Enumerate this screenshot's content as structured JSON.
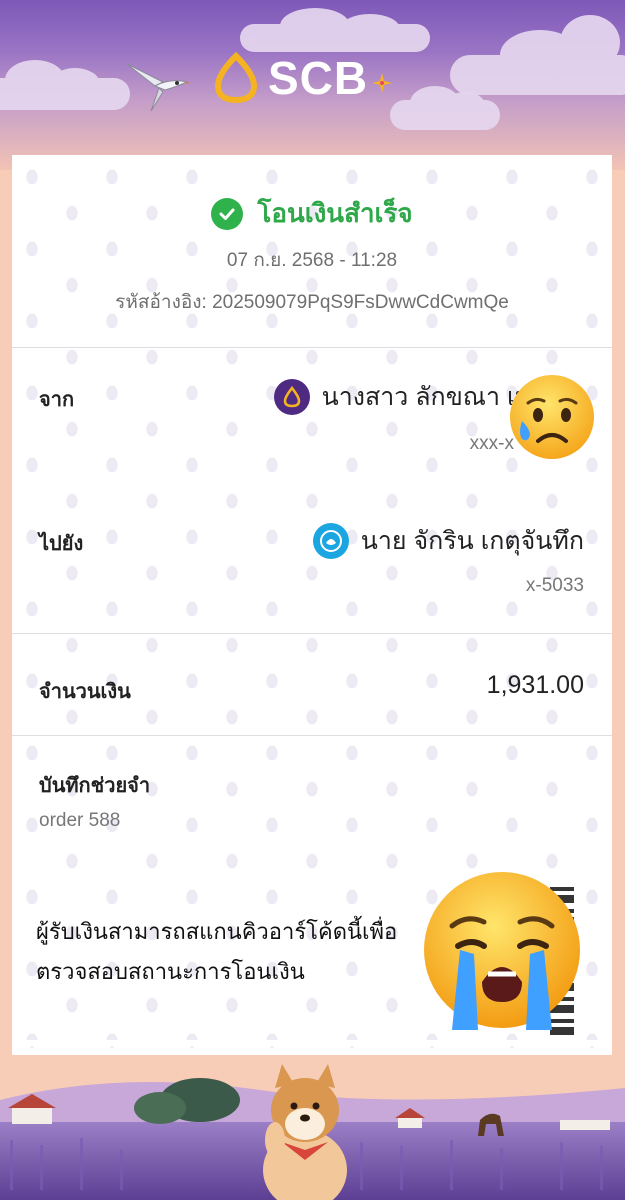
{
  "brand": {
    "name": "SCB"
  },
  "status": {
    "text": "โอนเงินสำเร็จ"
  },
  "datetime": "07 ก.ย. 2568 - 11:28",
  "reference": "รหัสอ้างอิง: 202509079PqS9FsDwwCdCwmQe",
  "from": {
    "label": "จาก",
    "name": "นางสาว ลักขณา เพ",
    "account": "xxx-x",
    "bank_icon": "scb-logo-icon"
  },
  "to": {
    "label": "ไปยัง",
    "name": "นาย จักริน เกตุจันทึก",
    "account": "x-5033",
    "bank_icon": "ktb-logo-icon"
  },
  "amount": {
    "label": "จำนวนเงิน",
    "value": "1,931.00"
  },
  "note": {
    "label": "บันทึกช่วยจำ",
    "value": "order 588"
  },
  "qr_message": "ผู้รับเงินสามารถสแกนคิวอาร์โค้ดนี้เพื่อตรวจสอบสถานะการโอนเงิน",
  "stickers": [
    "sad-relieved-face-emoji",
    "loudly-crying-face-emoji"
  ],
  "colors": {
    "success": "#2fb24c",
    "brand_purple": "#4e2a83",
    "brand_gold": "#f4b400",
    "background": "#f7cdb8"
  }
}
